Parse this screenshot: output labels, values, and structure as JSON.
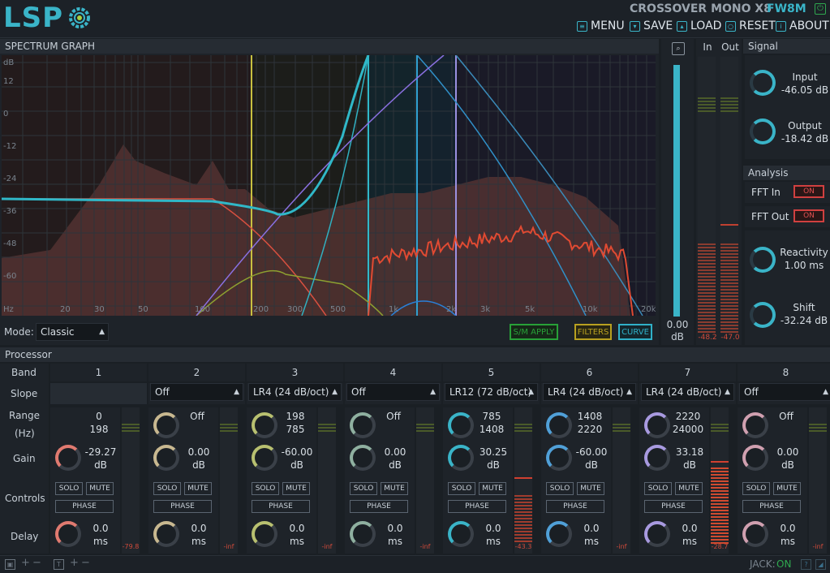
{
  "header": {
    "logo": "LSP",
    "plugin_title": "CROSSOVER MONO X8",
    "plugin_variant": "FW8M",
    "menu": [
      {
        "label": "MENU",
        "icon": "menu-icon"
      },
      {
        "label": "SAVE",
        "icon": "save-icon"
      },
      {
        "label": "LOAD",
        "icon": "load-icon"
      },
      {
        "label": "RESET",
        "icon": "reset-icon"
      },
      {
        "label": "ABOUT",
        "icon": "about-icon"
      }
    ]
  },
  "spectrum": {
    "title": "SPECTRUM GRAPH",
    "db_axis": [
      "dB",
      "12",
      "0",
      "-12",
      "-24",
      "-36",
      "-48",
      "-60"
    ],
    "freq_axis": [
      "Hz",
      "20",
      "30",
      "50",
      "100",
      "200",
      "300",
      "500",
      "1k",
      "2k",
      "3k",
      "5k",
      "10k",
      "20k"
    ],
    "mode_label": "Mode:",
    "mode_value": "Classic",
    "buttons": {
      "sm_apply": "S/M APPLY",
      "filters": "FILTERS",
      "curve": "CURVE"
    },
    "zoom_value": "0.00",
    "zoom_unit": "dB",
    "meter_in_label": "In",
    "meter_out_label": "Out",
    "meter_in_value": "-48.2",
    "meter_out_value": "-47.0"
  },
  "signal": {
    "title": "Signal",
    "input_label": "Input",
    "input_value": "-46.05 dB",
    "output_label": "Output",
    "output_value": "-18.42 dB"
  },
  "analysis": {
    "title": "Analysis",
    "fft_in_label": "FFT In",
    "fft_in_value": "ON",
    "fft_out_label": "FFT Out",
    "fft_out_value": "ON",
    "reactivity_label": "Reactivity",
    "reactivity_value": "1.00 ms",
    "shift_label": "Shift",
    "shift_value": "-32.24 dB"
  },
  "processor": {
    "title": "Processor",
    "row_labels": {
      "band": "Band",
      "slope": "Slope",
      "range": "Range",
      "range_unit": "(Hz)",
      "gain": "Gain",
      "controls": "Controls",
      "delay": "Delay"
    },
    "solo_label": "SOLO",
    "mute_label": "MUTE",
    "phase_label": "PHASE",
    "bands": [
      {
        "num": "1",
        "slope": "",
        "range_lo": "0",
        "range_hi": "198",
        "gain": "-29.27",
        "gain_unit": "dB",
        "delay": "0.0",
        "delay_unit": "ms",
        "meter": "-79.8",
        "color": "#e07a70"
      },
      {
        "num": "2",
        "slope": "Off",
        "range_lo": "Off",
        "range_hi": "",
        "gain": "0.00",
        "gain_unit": "dB",
        "delay": "0.0",
        "delay_unit": "ms",
        "meter": "-inf",
        "color": "#c8b890"
      },
      {
        "num": "3",
        "slope": "LR4 (24 dB/oct)",
        "range_lo": "198",
        "range_hi": "785",
        "gain": "-60.00",
        "gain_unit": "dB",
        "delay": "0.0",
        "delay_unit": "ms",
        "meter": "-inf",
        "color": "#b8c070"
      },
      {
        "num": "4",
        "slope": "Off",
        "range_lo": "Off",
        "range_hi": "",
        "gain": "0.00",
        "gain_unit": "dB",
        "delay": "0.0",
        "delay_unit": "ms",
        "meter": "-inf",
        "color": "#8fb0a0"
      },
      {
        "num": "5",
        "slope": "LR12 (72 dB/oct)",
        "range_lo": "785",
        "range_hi": "1408",
        "gain": "30.25",
        "gain_unit": "dB",
        "delay": "0.0",
        "delay_unit": "ms",
        "meter": "-43.3",
        "color": "#3ab4c8"
      },
      {
        "num": "6",
        "slope": "LR4 (24 dB/oct)",
        "range_lo": "1408",
        "range_hi": "2220",
        "gain": "-60.00",
        "gain_unit": "dB",
        "delay": "0.0",
        "delay_unit": "ms",
        "meter": "-inf",
        "color": "#50a0d8"
      },
      {
        "num": "7",
        "slope": "LR4 (24 dB/oct)",
        "range_lo": "2220",
        "range_hi": "24000",
        "gain": "33.18",
        "gain_unit": "dB",
        "delay": "0.0",
        "delay_unit": "ms",
        "meter": "-28.7",
        "color": "#a89ae0"
      },
      {
        "num": "8",
        "slope": "Off",
        "range_lo": "Off",
        "range_hi": "",
        "gain": "0.00",
        "gain_unit": "dB",
        "delay": "0.0",
        "delay_unit": "ms",
        "meter": "-inf",
        "color": "#d0a0b0"
      }
    ]
  },
  "footer": {
    "jack_label": "JACK:",
    "jack_value": "ON"
  }
}
